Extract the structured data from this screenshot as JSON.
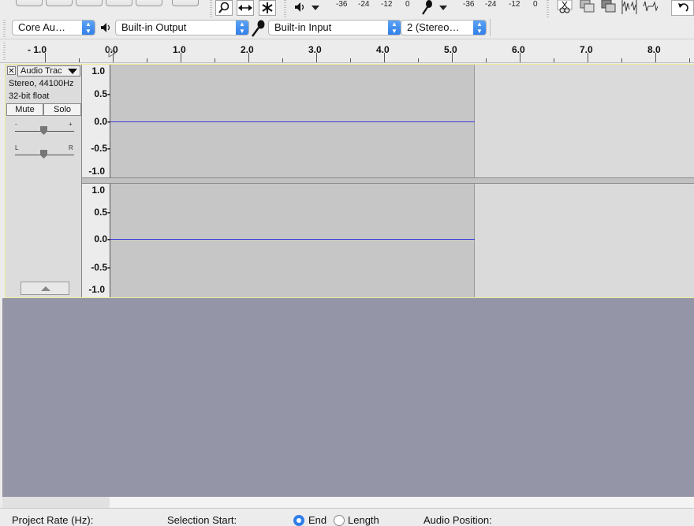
{
  "device_toolbar": {
    "host": "Core Au…",
    "output_device": "Built-in Output",
    "input_device": "Built-in Input",
    "input_channels": "2 (Stereo…"
  },
  "meters": {
    "playback_scale": [
      "-36",
      "-24",
      "-12",
      "0"
    ],
    "record_scale": [
      "-36",
      "-24",
      "-12",
      "0"
    ]
  },
  "icons": {
    "zoom": "zoom-icon",
    "timeshift": "timeshift-icon",
    "multi": "multi-tool-icon",
    "speaker": "speaker-icon",
    "microphone": "microphone-icon",
    "trim": "trim-icon",
    "silence": "silence-icon",
    "undo": "undo-icon"
  },
  "ruler": {
    "labels": [
      "- 1.0",
      "0.0",
      "1.0",
      "2.0",
      "3.0",
      "4.0",
      "5.0",
      "6.0",
      "7.0",
      "8.0"
    ]
  },
  "track": {
    "name": "Audio Trac",
    "info_rate": "Stereo, 44100Hz",
    "info_format": "32-bit float",
    "mute_label": "Mute",
    "solo_label": "Solo",
    "gain_minus": "-",
    "gain_plus": "+",
    "pan_left": "L",
    "pan_right": "R",
    "channel_scale": [
      "1.0",
      "0.5-",
      "0.0-",
      "-0.5-",
      "-1.0"
    ]
  },
  "selection_toolbar": {
    "project_rate_label": "Project Rate (Hz):",
    "selection_start_label": "Selection Start:",
    "end_label": "End",
    "length_label": "Length",
    "audio_position_label": "Audio Position:"
  },
  "colors": {
    "waveform_line": "#3b3bdf",
    "clip_background": "#c6c6c6",
    "empty_area": "#9495a6",
    "track_focus_border": "#ecec9a",
    "select_stepper": "#2f7ee9"
  }
}
